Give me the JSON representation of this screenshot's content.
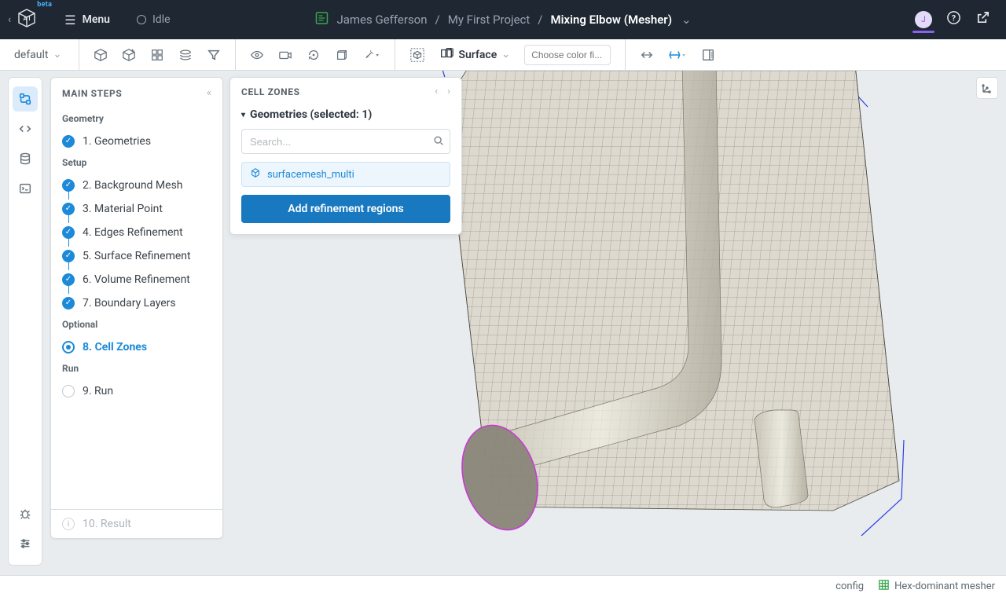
{
  "header": {
    "menu_label": "Menu",
    "status_label": "Idle",
    "logo_badge": "beta",
    "breadcrumb": {
      "user": "James Gefferson",
      "project": "My First Project",
      "document": "Mixing Elbow (Mesher)",
      "sep": " / "
    },
    "avatar_initial": "J"
  },
  "toolbar": {
    "preset_label": "default",
    "mode_label": "Surface",
    "color_placeholder": "Choose color fi..."
  },
  "steps_panel": {
    "title": "MAIN STEPS",
    "sections": {
      "geometry_label": "Geometry",
      "setup_label": "Setup",
      "optional_label": "Optional",
      "run_label": "Run"
    },
    "steps": {
      "s1": "1. Geometries",
      "s2": "2. Background Mesh",
      "s3": "3. Material Point",
      "s4": "4. Edges Refinement",
      "s5": "5. Surface Refinement",
      "s6": "6. Volume Refinement",
      "s7": "7. Boundary Layers",
      "s8": "8. Cell Zones",
      "s9": "9. Run"
    },
    "result_label": "10. Result"
  },
  "cell_zones": {
    "title": "CELL ZONES",
    "geometries_label": "Geometries (selected: 1)",
    "search_placeholder": "Search...",
    "items": {
      "i0": "surfacemesh_multi"
    },
    "add_button": "Add refinement regions"
  },
  "statusbar": {
    "config_label": "config",
    "mesher_label": "Hex-dominant mesher"
  }
}
